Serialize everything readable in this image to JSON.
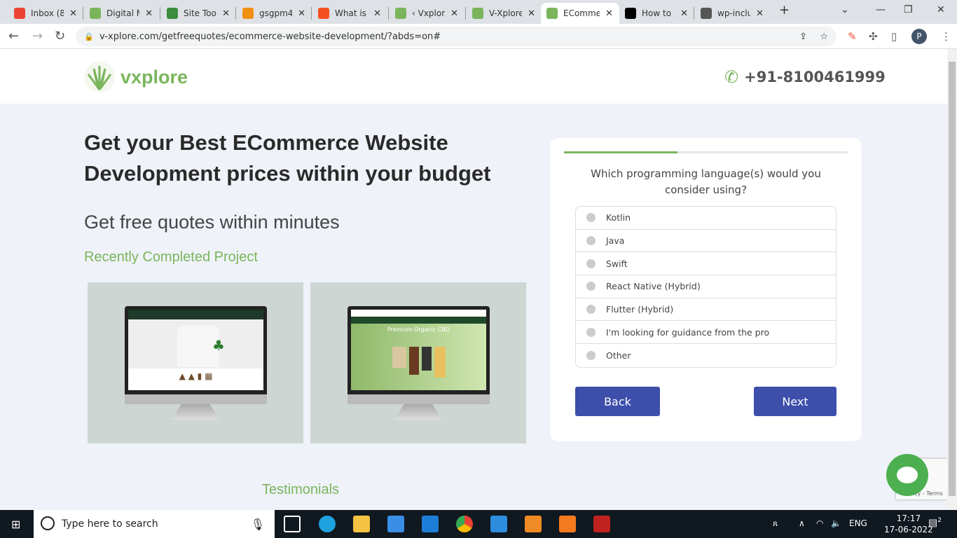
{
  "browser": {
    "tabs": [
      {
        "title": "Inbox (8)",
        "icon": "gmail-icon",
        "color": "#ea4335"
      },
      {
        "title": "Digital M",
        "icon": "vxplore-icon",
        "color": "#7ab55c"
      },
      {
        "title": "Site Tool",
        "icon": "sitetool-icon",
        "color": "#3c8d3c"
      },
      {
        "title": "gsgpm4",
        "icon": "pma-icon",
        "color": "#f29111"
      },
      {
        "title": "What is t",
        "icon": "question-icon",
        "color": "#f4511e"
      },
      {
        "title": "‹ Vxplore",
        "icon": "vxplore-icon",
        "color": "#7ab55c"
      },
      {
        "title": "V-Xplore",
        "icon": "vxplore-icon",
        "color": "#7ab55c"
      },
      {
        "title": "EComme",
        "icon": "vxplore-icon",
        "color": "#7ab55c",
        "active": true
      },
      {
        "title": "How to",
        "icon": "aw-icon",
        "color": "#000000"
      },
      {
        "title": "wp-inclu",
        "icon": "wordpress-icon",
        "color": "#555555"
      }
    ],
    "url": "v-xplore.com/getfreequotes/ecommerce-website-development/?abds=on#",
    "profile_initial": "P"
  },
  "header": {
    "logo": "vxplore",
    "phone": "+91-8100461999"
  },
  "hero": {
    "title": "Get your Best ECommerce Website Development prices within your budget",
    "subtitle": "Get free quotes within minutes",
    "projects_heading": "Recently Completed Project",
    "project2_caption": "Premium Organic CBD",
    "testimonials": "Testimonials"
  },
  "form": {
    "progress_percent": 40,
    "question": "Which programming language(s) would you consider using?",
    "options": [
      "Kotlin",
      "Java",
      "Swift",
      "React Native (Hybrid)",
      "Flutter (Hybrid)",
      "I'm looking for guidance from the pro",
      "Other"
    ],
    "back": "Back",
    "next": "Next"
  },
  "recaptcha": "Privacy - Terms",
  "taskbar": {
    "search_placeholder": "Type here to search",
    "lang": "ENG",
    "time": "17:17",
    "date": "17-06-2022",
    "notifications": "2"
  },
  "colors": {
    "accent_green": "#7ab55c",
    "button_blue": "#3d4fab"
  }
}
